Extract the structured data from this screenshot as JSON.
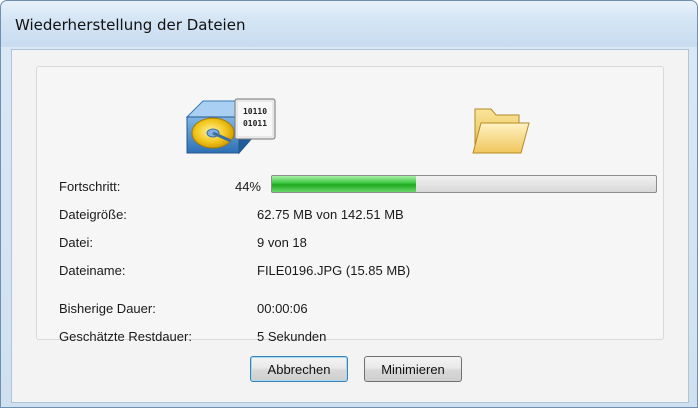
{
  "window": {
    "title": "Wiederherstellung der Dateien"
  },
  "progress": {
    "label": "Fortschritt:",
    "percent_text": "44%",
    "fraction": 0.376,
    "fill_color": "#2eb62f"
  },
  "details": {
    "size_label": "Dateigröße:",
    "size_value": "62.75 MB von 142.51 MB",
    "file_label": "Datei:",
    "file_value": "9 von 18",
    "name_label": "Dateiname:",
    "name_value": "FILE0196.JPG (15.85 MB)",
    "elapsed_label": "Bisherige Dauer:",
    "elapsed_value": "00:00:06",
    "remaining_label": "Geschätzte Restdauer:",
    "remaining_value": "5 Sekunden"
  },
  "icons": {
    "source": "hard-disk-binary-icon",
    "source_binary_line1": "10110",
    "source_binary_line2": "01011",
    "target": "open-folder-icon"
  },
  "buttons": {
    "cancel_label": "Abbrechen",
    "minimize_label": "Minimieren"
  }
}
